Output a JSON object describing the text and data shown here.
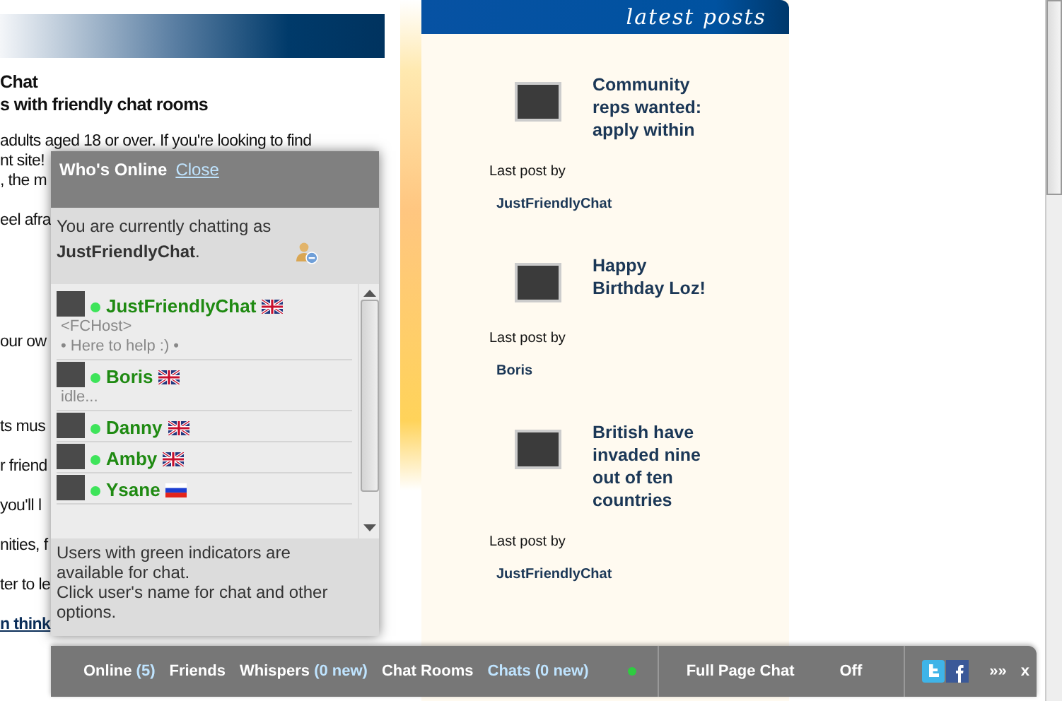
{
  "intro": {
    "title": "Chat",
    "subtitle": "s with friendly chat rooms"
  },
  "paragraphs": [
    [
      "adults aged 18 or over. If you're looking to find",
      "nt site!",
      ", the m"
    ],
    [
      "eel afra"
    ],
    [
      "our ow"
    ],
    [
      "ts mus"
    ],
    [
      "r friend"
    ],
    [
      "you'll l"
    ],
    [
      "nities, f"
    ],
    [
      "ter to le"
    ]
  ],
  "link": "n think",
  "latest_posts": {
    "title": "latest posts",
    "posts": [
      {
        "title": "Community reps wanted: apply within",
        "byline": "Last post by",
        "author": "JustFriendlyChat"
      },
      {
        "title": "Happy Birthday Loz!",
        "byline": "Last post by",
        "author": "Boris"
      },
      {
        "title": "British have invaded nine out of ten countries",
        "byline": "Last post by",
        "author": "JustFriendlyChat"
      }
    ]
  },
  "whos_online": {
    "title": "Who's Online",
    "close": "Close",
    "status": "You are currently chatting as **JustFriendlyChat**.",
    "users": [
      {
        "name": "JustFriendlyChat",
        "online": true,
        "kind": "uk",
        "lines": [
          "<FCHost>",
          "• Here to help :) •"
        ]
      },
      {
        "name": "Boris",
        "online": true,
        "kind": "uk",
        "lines": [
          "idle..."
        ]
      },
      {
        "name": "Danny",
        "online": true,
        "kind": "uk"
      },
      {
        "name": "Amby",
        "online": true,
        "kind": "uk"
      },
      {
        "name": "Ysane",
        "online": true,
        "kind": "ru"
      }
    ],
    "notes": [
      "Users with green indicators are available for chat.",
      "Click user's name for chat and other options."
    ]
  },
  "chat_bar": {
    "items": [
      {
        "label": "Online",
        "count": "(5)",
        "selected": false
      },
      {
        "label": "Friends",
        "selected": false
      },
      {
        "label": "Whispers",
        "count": "(0 new)",
        "selected": false
      },
      {
        "label": "Chat Rooms",
        "selected": false
      },
      {
        "label": "Chats",
        "count": "(0 new)",
        "selected": true
      }
    ],
    "available": true,
    "full_page_chat": {
      "label": "Full Page Chat",
      "value": "Off"
    },
    "more": "»»",
    "close": "x"
  }
}
